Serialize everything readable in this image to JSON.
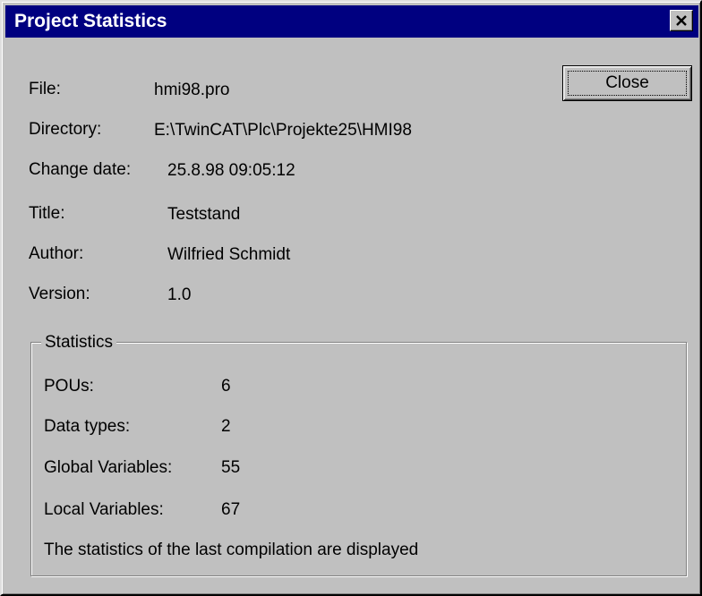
{
  "window": {
    "title": "Project Statistics"
  },
  "buttons": {
    "close_label": "Close"
  },
  "file_info": [
    {
      "label": "File:",
      "value": "hmi98.pro"
    },
    {
      "label": "Directory:",
      "value": "E:\\TwinCAT\\Plc\\Projekte25\\HMI98"
    },
    {
      "label": "Change date:",
      "value": "25.8.98 09:05:12"
    },
    {
      "label": "Title:",
      "value": "Teststand"
    },
    {
      "label": "Author:",
      "value": "Wilfried Schmidt"
    },
    {
      "label": "Version:",
      "value": "1.0"
    }
  ],
  "statistics": {
    "group_title": "Statistics",
    "rows": [
      {
        "label": "POUs:",
        "value": "6"
      },
      {
        "label": "Data types:",
        "value": "2"
      },
      {
        "label": "Global Variables:",
        "value": "55"
      },
      {
        "label": "Local Variables:",
        "value": "67"
      }
    ],
    "note": "The statistics of the last compilation are displayed"
  },
  "colors": {
    "titlebar": "#000080",
    "dialog_background": "#c0c0c0"
  },
  "icons": {
    "title_close": "close-icon"
  }
}
